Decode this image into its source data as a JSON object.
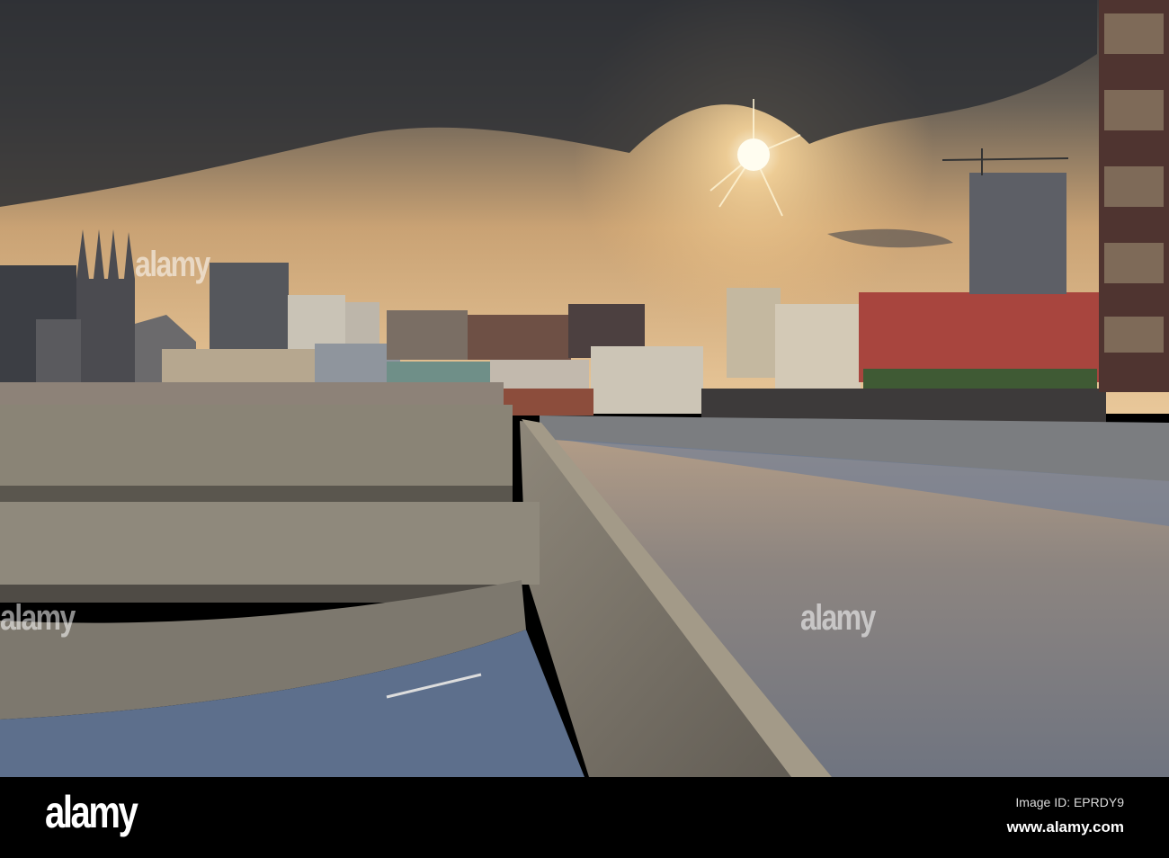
{
  "watermark": {
    "text": "alamy"
  },
  "footer": {
    "logo": "alamy",
    "image_id": "Image ID: EPRDY9",
    "site": "www.alamy.com"
  },
  "colors": {
    "sky_glow": "#e8b878",
    "cloud": "#2e3035",
    "concrete": "#8a8476",
    "deck": "#7f8590"
  }
}
